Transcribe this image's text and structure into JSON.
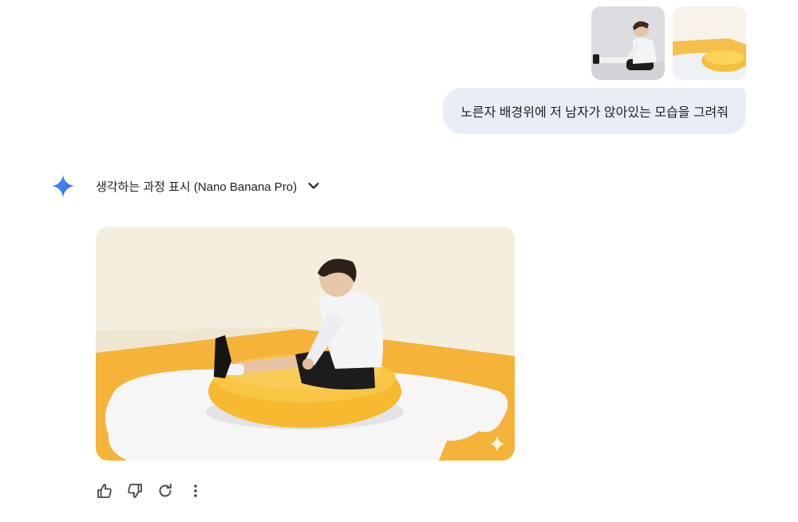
{
  "conversation": {
    "user_message": {
      "text": "노른자 배경위에 저 남자가 앉아있는 모습을 그려줘",
      "attachments": [
        {
          "icon": "attached-photo-man-sitting"
        },
        {
          "icon": "attached-photo-yellow-cushion"
        }
      ]
    },
    "model_response": {
      "thinking_toggle_label": "생각하는 과정 표시 (Nano Banana Pro)",
      "generated_image": {
        "icon": "generated-image-man-on-egg-yolk"
      },
      "actions": [
        {
          "icon": "thumbs-up-icon"
        },
        {
          "icon": "thumbs-down-icon"
        },
        {
          "icon": "regenerate-icon"
        },
        {
          "icon": "more-options-icon"
        }
      ]
    }
  },
  "colors": {
    "user_bubble_bg": "#e9eef6",
    "gemini_blue": "#4285f4",
    "yolk_yellow": "#f7c443",
    "floor_orange": "#f5b33a"
  }
}
